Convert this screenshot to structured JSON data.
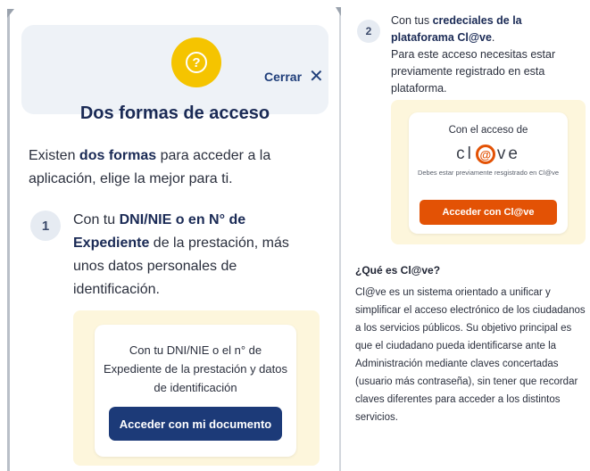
{
  "header": {
    "title": "Dos formas de acceso",
    "close_label": "Cerrar",
    "help_glyph": "?",
    "close_glyph": "✕"
  },
  "intro": {
    "part1": "Existen ",
    "bold": "dos formas",
    "part2": " para acceder a la aplicación, elige la mejor para ti."
  },
  "step1": {
    "number": "1",
    "part1": "Con tu ",
    "bold1": "DNI/NIE o en N° de Expediente",
    "part2": " de la prestación, más unos datos personales de identificación.",
    "card_text": "Con tu DNI/NIE o el n° de Expediente de la prestación y datos de identificación",
    "button_label": "Acceder con mi documento"
  },
  "step2": {
    "number": "2",
    "part1": "Con tus ",
    "bold1": "credeciales de la plataforama Cl@ve",
    "part2": ".",
    "line2": "Para este acceso necesitas estar previamente registrado en esta plataforma.",
    "card_label": "Con el acceso de",
    "logo_left": "cl",
    "logo_at": "@",
    "logo_right": "ve",
    "card_note": "Debes estar previamente resgistrado en Cl@ve",
    "button_label": "Acceder con Cl@ve"
  },
  "clave_info": {
    "title": "¿Qué es Cl@ve?",
    "text": "Cl@ve es un sistema orientado a unificar y simplificar el acceso electrónico de los ciudadanos a los servicios públicos. Su objetivo principal es que el ciudadano pueda identificarse ante la Administración mediante claves concertadas (usuario más contraseña), sin tener que recordar claves diferentes para acceder a los distintos servicios."
  },
  "colors": {
    "accent_yellow": "#f5c400",
    "primary_blue": "#1c3a78",
    "clave_orange": "#e35205",
    "panel_yellow": "#fdf6dc",
    "header_bg": "#eef2f7"
  },
  "icons": {
    "help": "question-circle-icon",
    "close": "close-icon"
  }
}
